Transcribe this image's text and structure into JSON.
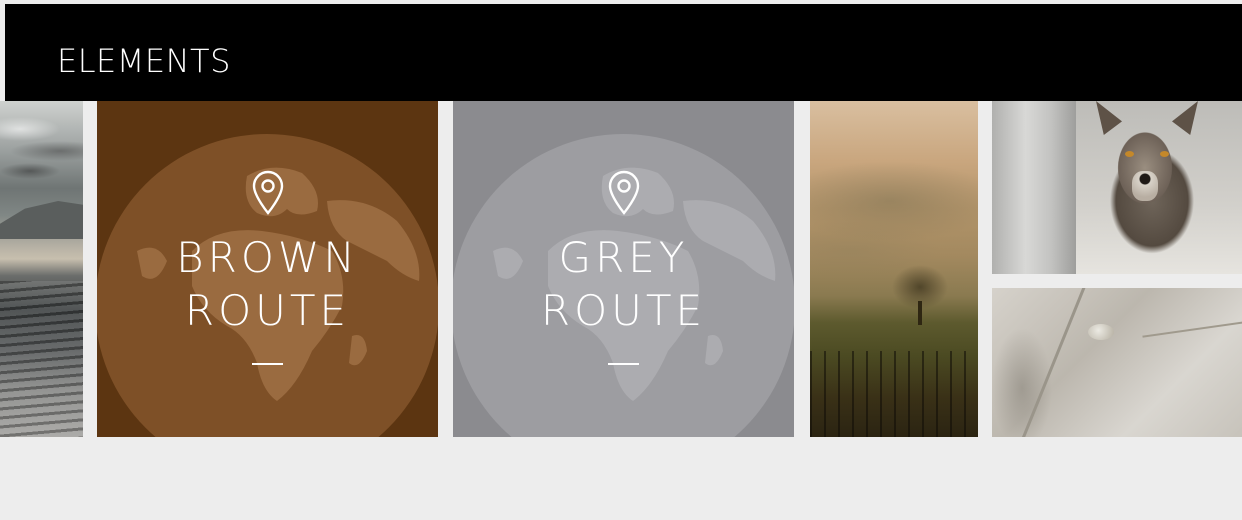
{
  "header": {
    "title": "ELEMENTS"
  },
  "routes": [
    {
      "line1": "BROWN",
      "line2": "ROUTE",
      "color": "#5c3511"
    },
    {
      "line1": "GREY",
      "line2": "ROUTE",
      "color": "#8b8b8f"
    }
  ],
  "icons": {
    "route_marker": "location-pin-icon",
    "globe": "globe-icon"
  }
}
